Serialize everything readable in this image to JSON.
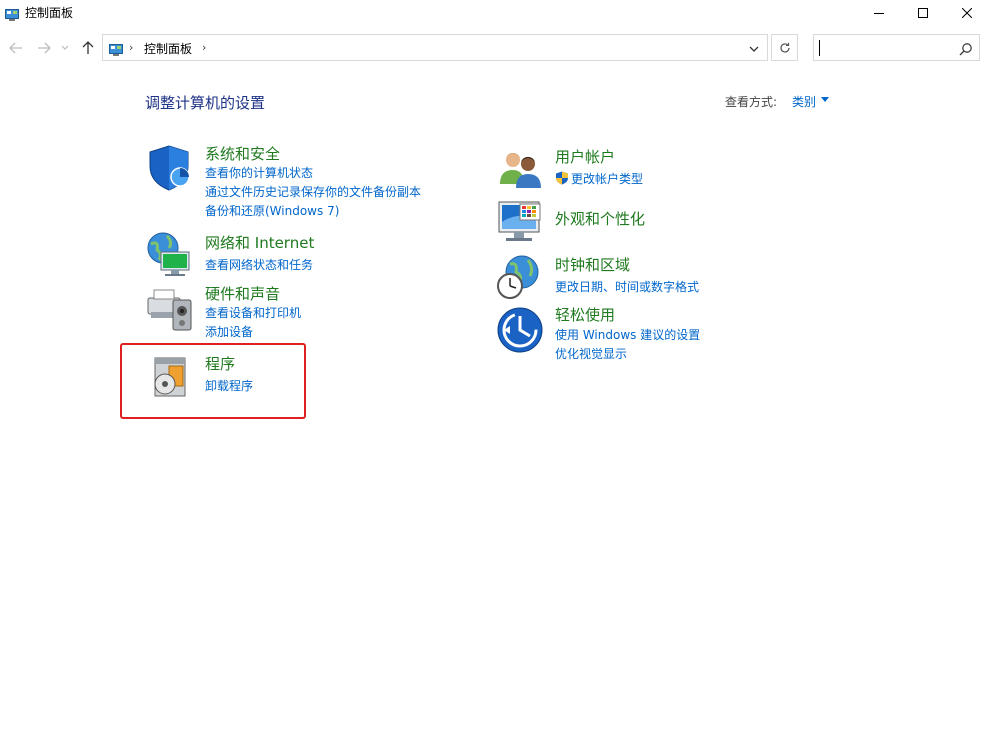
{
  "window": {
    "title": "控制面板"
  },
  "address_bar": {
    "path": "控制面板"
  },
  "page": {
    "title": "调整计算机的设置",
    "view_by_label": "查看方式:",
    "view_by_value": "类别"
  },
  "categories": {
    "system": {
      "title": "系统和安全",
      "links": [
        "查看你的计算机状态",
        "通过文件历史记录保存你的文件备份副本",
        "备份和还原(Windows 7)"
      ]
    },
    "network": {
      "title": "网络和 Internet",
      "links": [
        "查看网络状态和任务"
      ]
    },
    "hardware": {
      "title": "硬件和声音",
      "links": [
        "查看设备和打印机",
        "添加设备"
      ]
    },
    "programs": {
      "title": "程序",
      "links": [
        "卸载程序"
      ]
    },
    "accounts": {
      "title": "用户帐户",
      "links": [
        "更改帐户类型"
      ]
    },
    "appearance": {
      "title": "外观和个性化",
      "links": []
    },
    "clock": {
      "title": "时钟和区域",
      "links": [
        "更改日期、时间或数字格式"
      ]
    },
    "ease": {
      "title": "轻松使用",
      "links": [
        "使用 Windows 建议的设置",
        "优化视觉显示"
      ]
    }
  },
  "colors": {
    "category_title": "#1f7a1f",
    "link": "#0066cc",
    "page_title": "#1e3287",
    "highlight_box": "#e02020"
  },
  "icons": {
    "app": "control-panel-icon",
    "back": "arrow-left-icon",
    "forward": "arrow-right-icon",
    "recent": "chevron-down-icon",
    "up": "arrow-up-icon",
    "refresh": "refresh-icon",
    "search": "search-icon",
    "minimize": "minimize-icon",
    "maximize": "maximize-icon",
    "close": "close-icon"
  }
}
